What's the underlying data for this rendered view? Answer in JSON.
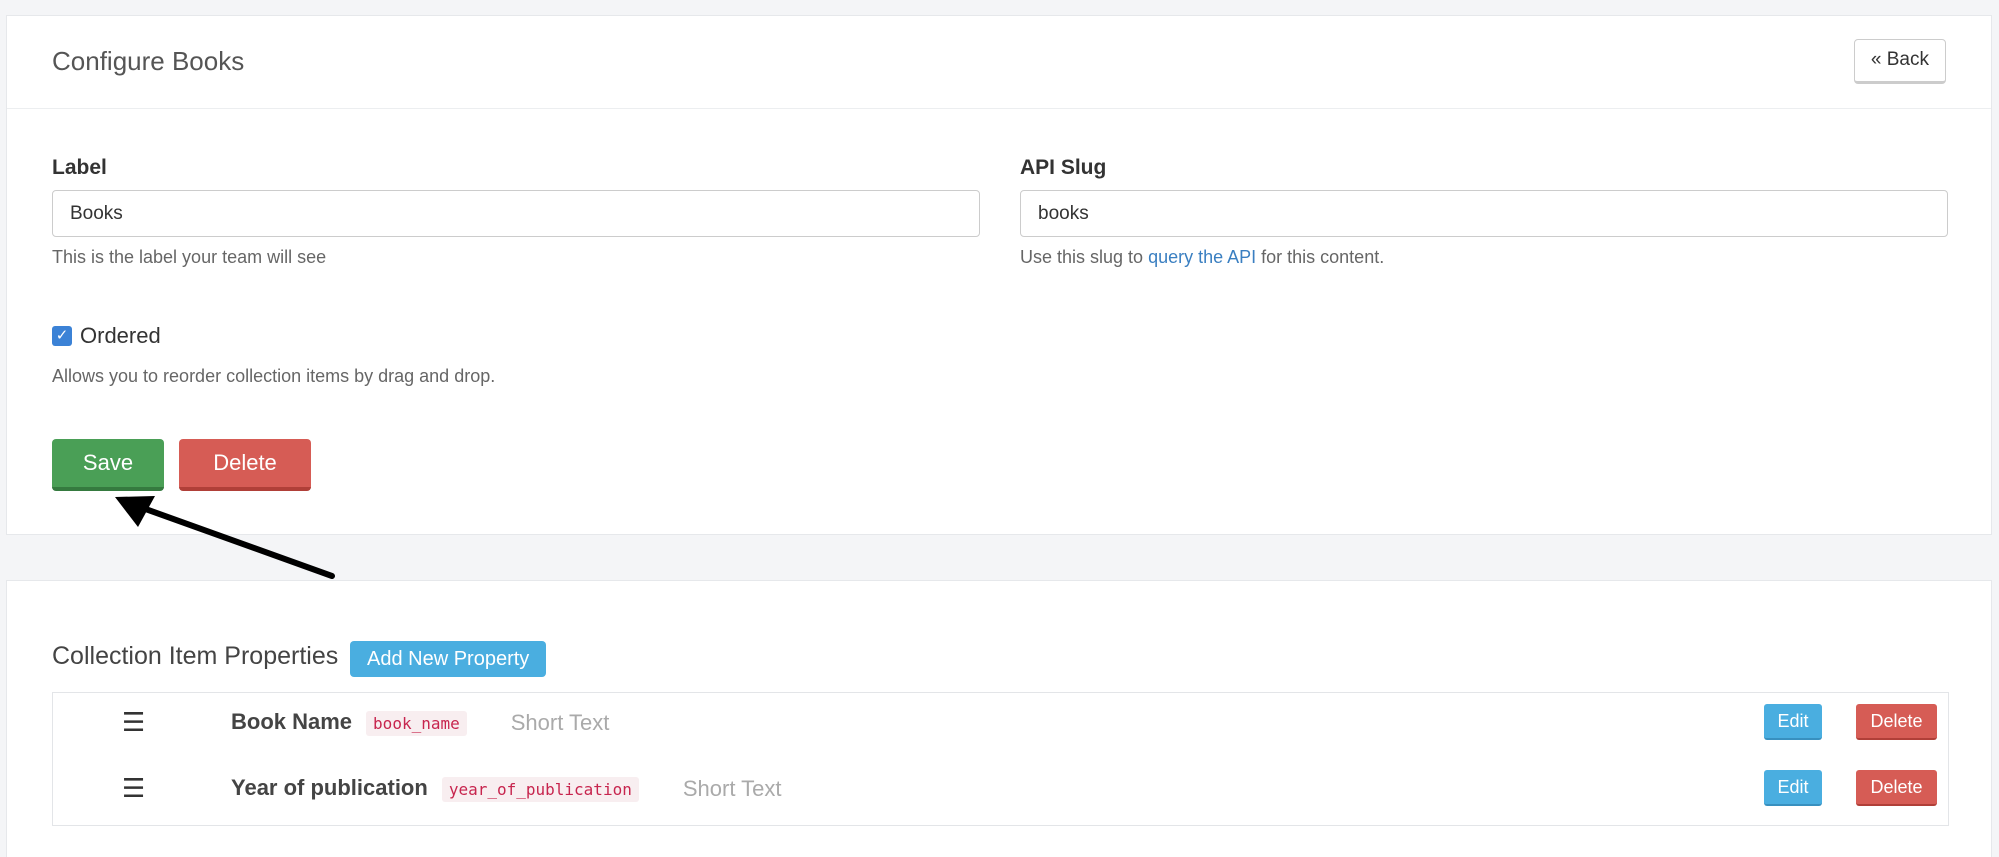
{
  "header": {
    "title": "Configure Books",
    "back_label": "« Back"
  },
  "form": {
    "label_field": {
      "label": "Label",
      "value": "Books",
      "help": "This is the label your team will see"
    },
    "slug_field": {
      "label": "API Slug",
      "value": "books",
      "help_prefix": "Use this slug to ",
      "help_link": "query the API",
      "help_suffix": " for this content."
    },
    "ordered": {
      "checked": true,
      "label": "Ordered",
      "help": "Allows you to reorder collection items by drag and drop."
    },
    "save_label": "Save",
    "delete_label": "Delete"
  },
  "properties": {
    "title": "Collection Item Properties",
    "add_label": "Add New Property",
    "rows": [
      {
        "name": "Book Name",
        "slug": "book_name",
        "type": "Short Text",
        "edit_label": "Edit",
        "delete_label": "Delete"
      },
      {
        "name": "Year of publication",
        "slug": "year_of_publication",
        "type": "Short Text",
        "edit_label": "Edit",
        "delete_label": "Delete"
      }
    ]
  },
  "colors": {
    "save": "#4a9f56",
    "delete": "#d65c55",
    "info": "#4aaee0",
    "link": "#3a7fc1"
  },
  "icons": {
    "drag": "drag-handle-icon",
    "check": "check-icon",
    "arrow": "arrow-annotation-icon"
  }
}
